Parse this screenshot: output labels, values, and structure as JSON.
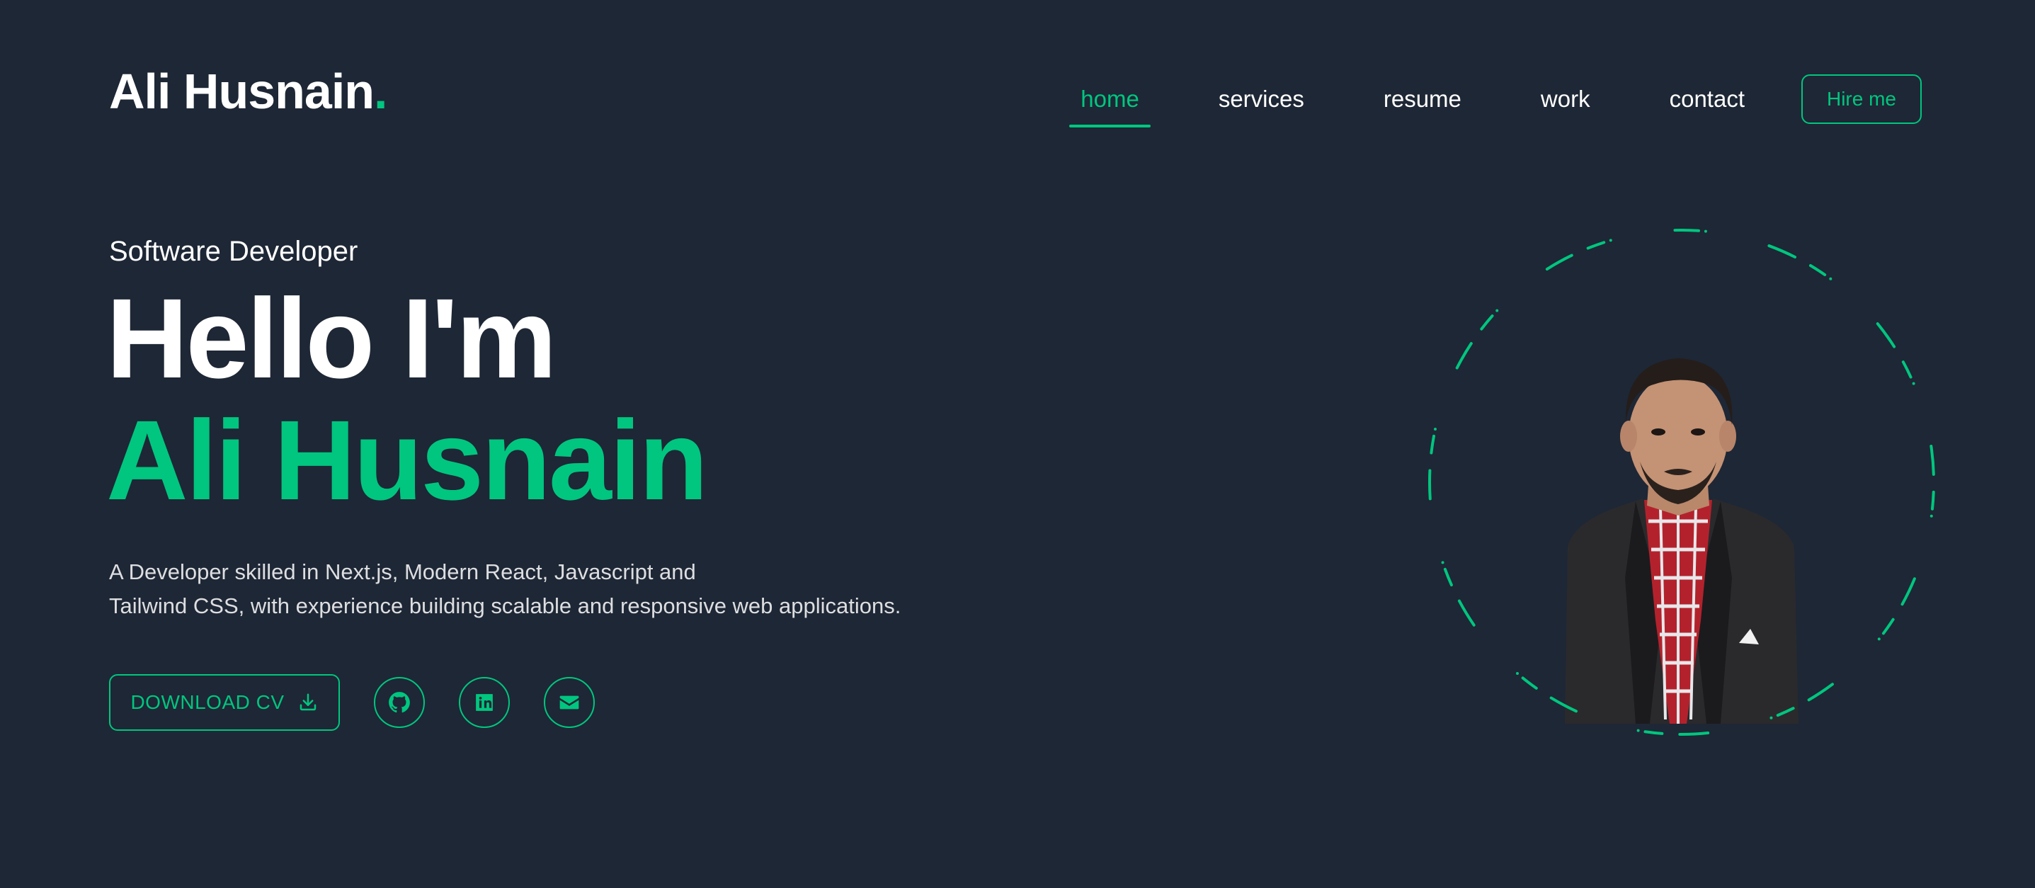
{
  "header": {
    "logo_text": "Ali Husnain",
    "logo_dot": "."
  },
  "nav": {
    "items": [
      {
        "label": "home",
        "active": true
      },
      {
        "label": "services",
        "active": false
      },
      {
        "label": "resume",
        "active": false
      },
      {
        "label": "work",
        "active": false
      },
      {
        "label": "contact",
        "active": false
      }
    ],
    "hire_label": "Hire me"
  },
  "hero": {
    "subtitle": "Software Developer",
    "greeting": "Hello I'm",
    "name": "Ali Husnain",
    "description_line1": "A Developer skilled in Next.js, Modern React, Javascript and",
    "description_line2": "Tailwind CSS, with experience building scalable and responsive web applications."
  },
  "actions": {
    "download_label": "DOWNLOAD CV",
    "download_icon": "download-icon",
    "socials": [
      {
        "name": "github-icon"
      },
      {
        "name": "linkedin-icon"
      },
      {
        "name": "email-icon"
      }
    ]
  },
  "colors": {
    "background": "#1e2735",
    "accent": "#00c67f",
    "text": "#ffffff"
  }
}
